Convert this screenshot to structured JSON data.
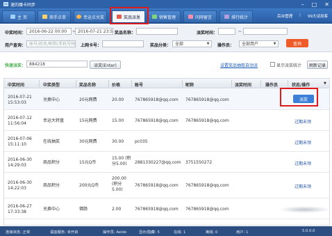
{
  "window": {
    "title": "速的魔卡同步",
    "min_btn": "–",
    "max_btn": "□",
    "close_btn": "✕"
  },
  "nav": {
    "tabs": [
      {
        "label": "主 页"
      },
      {
        "label": "商手点单"
      },
      {
        "label": "幸运点兑奖"
      },
      {
        "label": "奖品派发"
      },
      {
        "label": "销售管理"
      },
      {
        "label": "问网留言"
      },
      {
        "label": "排行统计"
      }
    ],
    "right": {
      "admin": "后台管理",
      "sep": "|",
      "user": "99大试用客"
    }
  },
  "search": {
    "row1": {
      "prize_time_label": "中奖时间：",
      "date_from": "2016-06-22 00:00",
      "to": "~",
      "date_to": "2016-07-21 23:59",
      "prize_name_label": "奖品名称：",
      "prize_name_value": "",
      "verify_time_label": "派奖时间：",
      "verify_from": "",
      "verify_to_sep": "~",
      "verify_to": ""
    },
    "row2": {
      "user_query_label": "用户查询：",
      "user_query_placeholder": "账号/姓名/昵称/手机号码",
      "card_label": "上网卡号：",
      "card_value": "",
      "category_label": "奖品分类：",
      "category_value": "全部",
      "operator_label": "操作员：",
      "operator_value": "全部用户",
      "query_button": "查询"
    }
  },
  "verify": {
    "label": "快速派奖：",
    "value": "884218",
    "button": "派奖(Enter)",
    "auto_link": "设置奖品抽取自动派",
    "show_stats_label": "显示派奖统计",
    "refresh_button": "刷新记录"
  },
  "table": {
    "columns": [
      "中奖时间",
      "中奖类型",
      "奖品名称",
      "价格",
      "账号",
      "昵称",
      "派奖时间",
      "操作员",
      "状态/操作"
    ],
    "rows": [
      {
        "date": "2016-07-21",
        "time": "15:53:03",
        "type": "兑换中心",
        "prize": "20元网费",
        "price": "20.00",
        "account": "767865918@qq.com",
        "nick": "767865918@qq.com",
        "action": "派奖",
        "status": ""
      },
      {
        "date": "2016-07-12",
        "time": "11:56:04",
        "type": "幸运大转盘",
        "prize": "15元网费",
        "price": "15.00",
        "account": "767865918@qq.com",
        "nick": "767865918@qq.com",
        "action": "",
        "status": "过期未领"
      },
      {
        "date": "2016-07-06",
        "time": "15:11:10",
        "type": "在线抽奖",
        "prize": "30元网费",
        "price": "30.00",
        "account": "pc035",
        "nick": "",
        "action": "",
        "status": "过期未领"
      },
      {
        "date": "2016-06-30",
        "time": "14:29:03",
        "type": "商品积分",
        "prize": "15元Q币",
        "price": "15.00 (积分5.00)",
        "account": "2881330227@qq.com",
        "nick": "3751550272",
        "action": "",
        "status": "过期未领"
      },
      {
        "date": "2016-06-30",
        "time": "14:22:03",
        "type": "商品积分",
        "prize": "200元Q币",
        "price": "200.00 (积分5.00)",
        "account": "767865918@qq.com",
        "nick": "767865918@qq.com",
        "action": "",
        "status": "过期未领"
      },
      {
        "date": "2016-06-27",
        "time": "17:33:38",
        "type": "兑换中心",
        "prize": "佛肠",
        "price": "2.00",
        "account": "767865918@qq.com",
        "nick": "767865918@qq.com",
        "action": "",
        "status": ""
      }
    ]
  },
  "statusbar": {
    "connection": "连接状态: 正常",
    "voice": "语音服务: 未开启",
    "operator": "操作员: Aeido",
    "display": "显示/隐藏: 5",
    "online": "在线: 1",
    "offline": "离线: 0",
    "user": "用户: 1",
    "version": "5.0.0.0"
  },
  "colors": {
    "nav_blue": "#2e62a8",
    "highlight_red": "#e0191b",
    "query_orange": "#f05a28",
    "action_blue": "#3b7fd6",
    "verify_green": "#4caf50"
  }
}
